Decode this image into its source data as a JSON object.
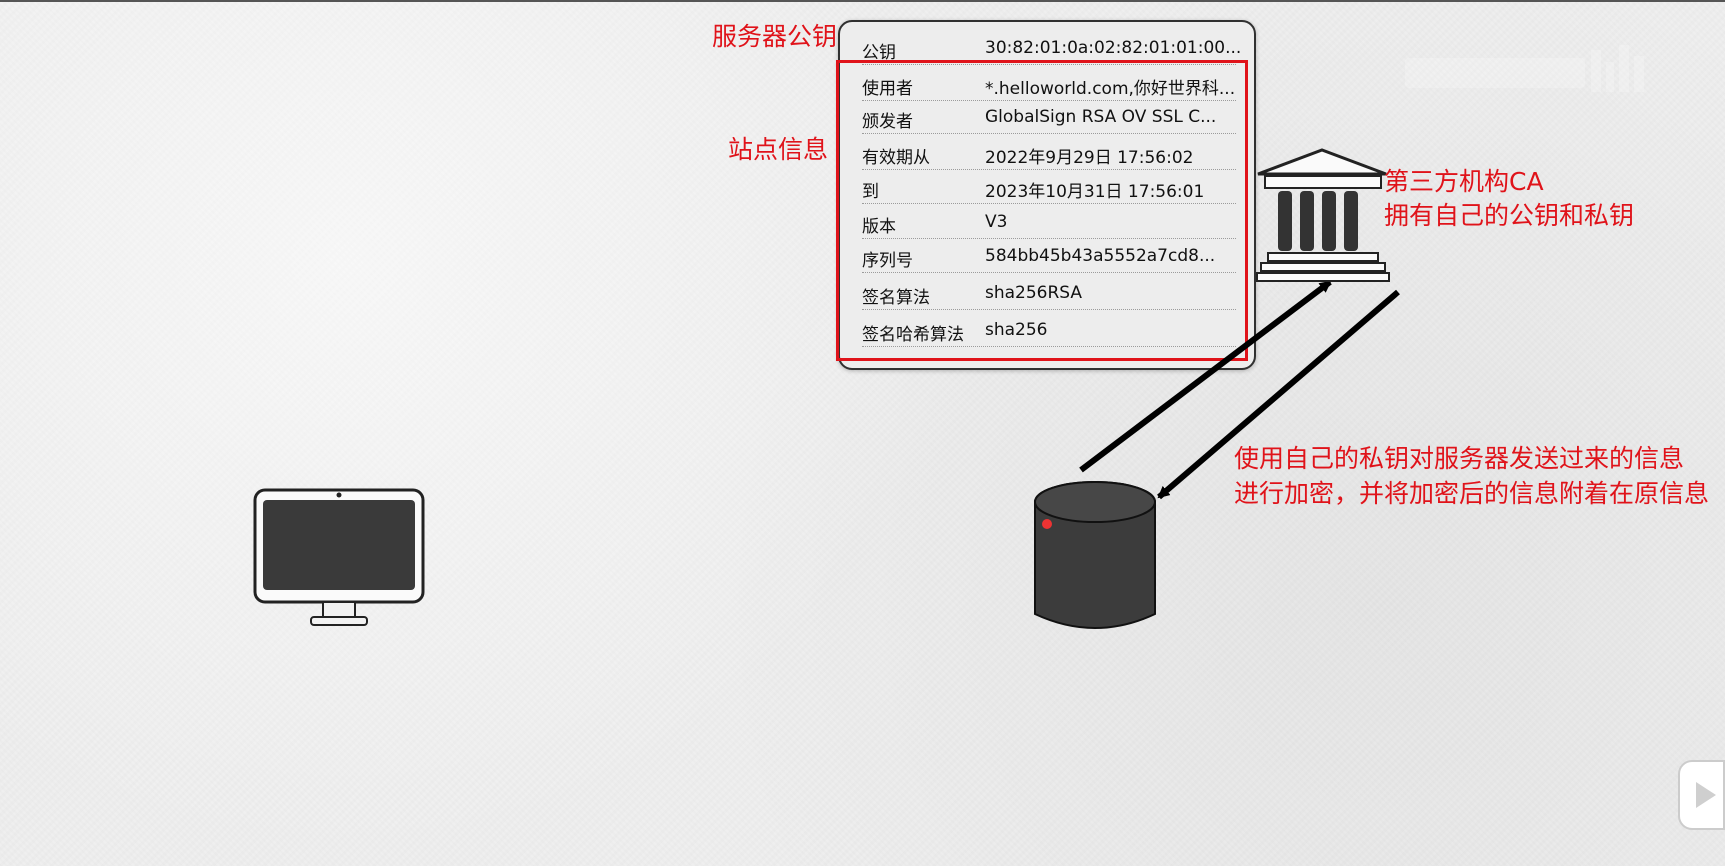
{
  "labels": {
    "server_public_key": "服务器公钥",
    "site_info": "站点信息",
    "ca_title": "第三方机构CA",
    "ca_desc": "拥有自己的公钥和私钥",
    "encrypt_line1": "使用自己的私钥对服务器发送过来的信息",
    "encrypt_line2": "进行加密，并将加密后的信息附着在原信息"
  },
  "certificate": {
    "rows": [
      {
        "key": "公钥",
        "value": "30:82:01:0a:02:82:01:01:00..."
      },
      {
        "key": "使用者",
        "value": "*.helloworld.com,你好世界科..."
      },
      {
        "key": "颁发者",
        "value": "GlobalSign RSA OV SSL C..."
      },
      {
        "key": "有效期从",
        "value": "2022年9月29日 17:56:02"
      },
      {
        "key": "到",
        "value": "2023年10月31日 17:56:01"
      },
      {
        "key": "版本",
        "value": "V3"
      },
      {
        "key": "序列号",
        "value": "584bb45b43a5552a7cd8..."
      },
      {
        "key": "签名算法",
        "value": "sha256RSA"
      },
      {
        "key": "签名哈希算法",
        "value": "sha256"
      }
    ]
  },
  "icons": {
    "client": "monitor-icon",
    "server": "database-icon",
    "ca": "bank-icon",
    "player": "play-icon"
  },
  "colors": {
    "annotation": "#e0131a",
    "icon": "#2c2c2c",
    "background": "#efefef"
  }
}
